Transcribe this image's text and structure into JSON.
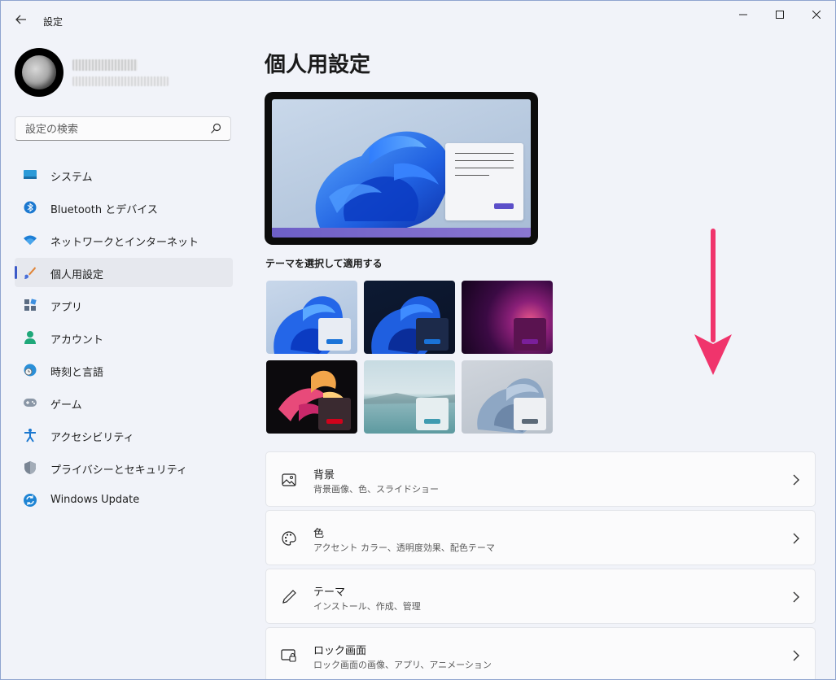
{
  "window": {
    "title": "設定",
    "back_icon": "back-arrow-icon",
    "controls": [
      "minimize-icon",
      "maximize-icon",
      "close-icon"
    ]
  },
  "user": {
    "avatar_icon": "moon-avatar"
  },
  "search": {
    "placeholder": "設定の検索",
    "icon": "search-icon"
  },
  "sidebar": {
    "items": [
      {
        "label": "システム",
        "icon": "system-icon",
        "active": false
      },
      {
        "label": "Bluetooth とデバイス",
        "icon": "bluetooth-icon",
        "active": false
      },
      {
        "label": "ネットワークとインターネット",
        "icon": "wifi-icon",
        "active": false
      },
      {
        "label": "個人用設定",
        "icon": "brush-icon",
        "active": true
      },
      {
        "label": "アプリ",
        "icon": "apps-icon",
        "active": false
      },
      {
        "label": "アカウント",
        "icon": "account-icon",
        "active": false
      },
      {
        "label": "時刻と言語",
        "icon": "time-language-icon",
        "active": false
      },
      {
        "label": "ゲーム",
        "icon": "gamepad-icon",
        "active": false
      },
      {
        "label": "アクセシビリティ",
        "icon": "accessibility-icon",
        "active": false
      },
      {
        "label": "プライバシーとセキュリティ",
        "icon": "shield-icon",
        "active": false
      },
      {
        "label": "Windows Update",
        "icon": "windows-update-icon",
        "active": false
      }
    ]
  },
  "main": {
    "title": "個人用設定",
    "themes_label": "テーマを選択して適用する",
    "themes": [
      {
        "name": "theme-light-bloom",
        "accent": "#1a73d8"
      },
      {
        "name": "theme-dark-bloom",
        "accent": "#1a73d8"
      },
      {
        "name": "theme-glow",
        "accent": "#7a1f9a"
      },
      {
        "name": "theme-captured-motion",
        "accent": "#d0021b"
      },
      {
        "name": "theme-sunrise",
        "accent": "#3f9bb0"
      },
      {
        "name": "theme-flow",
        "accent": "#5c6a78"
      }
    ],
    "cards": [
      {
        "title": "背景",
        "desc": "背景画像、色、スライドショー",
        "icon": "image-icon"
      },
      {
        "title": "色",
        "desc": "アクセント カラー、透明度効果、配色テーマ",
        "icon": "palette-icon"
      },
      {
        "title": "テーマ",
        "desc": "インストール、作成、管理",
        "icon": "pen-icon"
      },
      {
        "title": "ロック画面",
        "desc": "ロック画面の画像、アプリ、アニメーション",
        "icon": "lock-screen-icon"
      }
    ]
  },
  "colors": {
    "accent": "#3c5ac8",
    "arrow": "#f0346c"
  }
}
